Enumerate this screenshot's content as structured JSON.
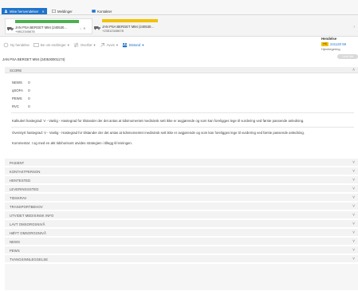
{
  "tabs": [
    {
      "label": "Mine henvendelser",
      "active": true
    },
    {
      "label": "Meldinger",
      "active": false
    },
    {
      "label": "Kontakter",
      "active": false
    }
  ],
  "cards": [
    {
      "name": "JAN PSA BERGET M94 (240530...",
      "phone": "+9812345678",
      "bar_color": "#4caf50"
    },
    {
      "name": "JAN PSA BERGET M94 (240530...",
      "phone": "+23512345678",
      "bar_color": "#f2c200"
    }
  ],
  "toolbar": {
    "items": [
      "Ny hendelse",
      "Be om endringer",
      "Overfør",
      "Avvis",
      "Bistand"
    ]
  },
  "hendelse": {
    "heading": "Hendelse",
    "badge": "H3",
    "number": "241120 59",
    "status": "Hjemlegering",
    "action": "Lukk fritt"
  },
  "patient_title": "JAN PSA BERGET M94 (240530001174)",
  "score": {
    "heading": "SCORE",
    "rows": [
      {
        "key": "NEWS",
        "value": "0"
      },
      {
        "key": "qSOFA",
        "value": "0"
      },
      {
        "key": "PEWS",
        "value": "0"
      },
      {
        "key": "RVC",
        "value": "0"
      }
    ],
    "kalkulert": "Kalkulert hastegrad: V - Vanlig - Hastegrad for tilstander der det antas at tidsmomentet medisinsk sett ikke er avgjørende og som kan foreligges lege til vurdering ved første passende anledning.",
    "overstyrt": "Overstyrt hastegrad: V - Vanlig - Hastegrad for tilstander der det antas at tidsmomentet medisinsk sett ikke er avgjørende og som kan foreligges lege til vurdering ved første passende anledning.",
    "kommentar": "Kommentar:   I og med en økt tidshorisont utvides strategien i tillegg til leiningen."
  },
  "sections": [
    "PASIENT",
    "KONTAKTPERSON",
    "HENTESTED",
    "LEVERINGSSTED",
    "TIDSKRAV",
    "TRANSPORTBEHOV",
    "UTVIDET MEDISINSK INFO",
    "LAVT OMSORGSNIVÅ",
    "HØYT OMSORGSNIVÅ",
    "NEWS",
    "PEWS",
    "TVANGSINNLEGGELSE"
  ],
  "colors": {
    "accent": "#1f73c9",
    "warning": "#f2c200",
    "ok": "#4caf50"
  }
}
